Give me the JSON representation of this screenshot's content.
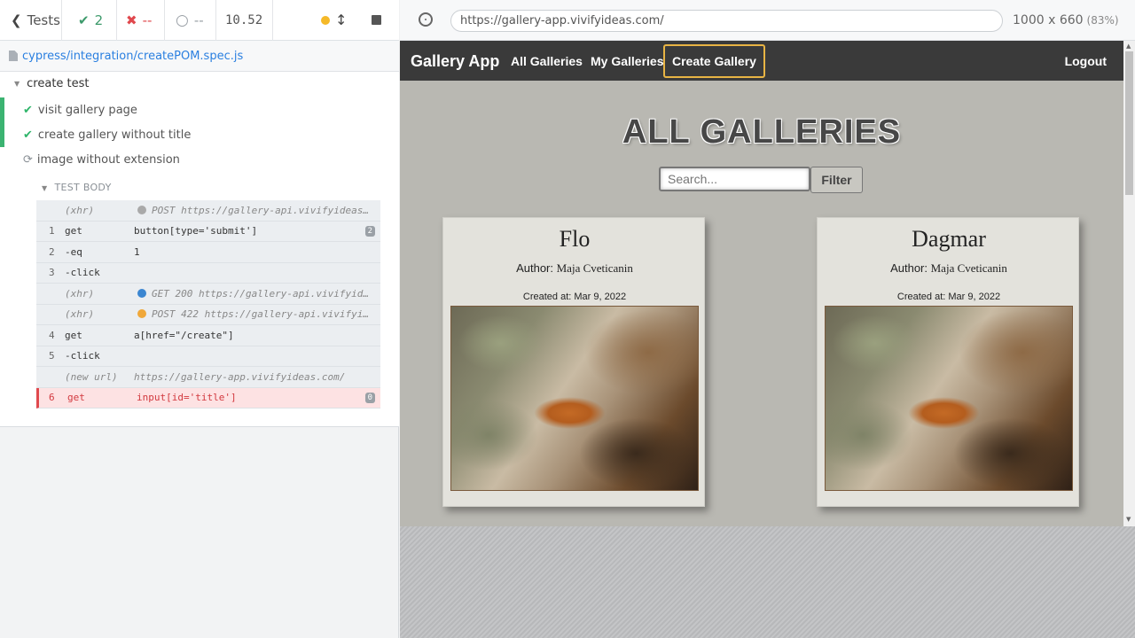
{
  "runner": {
    "tests_button": "Tests",
    "passed_count": "2",
    "failed_count": "--",
    "pending_count": "--",
    "duration": "10.52",
    "spec_file": "cypress/integration/createPOM.spec.js",
    "suite_title": "create test",
    "tests": [
      {
        "label": "visit gallery page",
        "state": "passed"
      },
      {
        "label": "create gallery without title",
        "state": "passed"
      },
      {
        "label": "image without extension",
        "state": "running"
      }
    ],
    "test_body_label": "TEST BODY",
    "commands": [
      {
        "num": "",
        "name": "(xhr)",
        "dot": "#a9a9a9",
        "msg": "POST https://gallery-api.vivifyideas...",
        "type": "xhr",
        "badge": ""
      },
      {
        "num": "1",
        "name": "get",
        "dot": "",
        "msg": "button[type='submit']",
        "type": "cmd",
        "badge": "2"
      },
      {
        "num": "2",
        "name": "-eq",
        "dot": "",
        "msg": "1",
        "type": "cmd",
        "badge": ""
      },
      {
        "num": "3",
        "name": "-click",
        "dot": "",
        "msg": "",
        "type": "cmd",
        "badge": ""
      },
      {
        "num": "",
        "name": "(xhr)",
        "dot": "#3b86d1",
        "msg": "GET 200 https://gallery-api.vivifyide...",
        "type": "xhr",
        "badge": ""
      },
      {
        "num": "",
        "name": "(xhr)",
        "dot": "#f0a83a",
        "msg": "POST 422 https://gallery-api.vivifyid...",
        "type": "xhr",
        "badge": ""
      },
      {
        "num": "4",
        "name": "get",
        "dot": "",
        "msg": "a[href=\"/create\"]",
        "type": "cmd",
        "badge": ""
      },
      {
        "num": "5",
        "name": "-click",
        "dot": "",
        "msg": "",
        "type": "cmd",
        "badge": ""
      },
      {
        "num": "",
        "name": "(new url)",
        "dot": "",
        "msg": "https://gallery-app.vivifyideas.com/",
        "type": "newurl",
        "badge": ""
      },
      {
        "num": "6",
        "name": "get",
        "dot": "",
        "msg": "input[id='title']",
        "type": "failed",
        "badge": "0"
      }
    ]
  },
  "aut": {
    "url": "https://gallery-app.vivifyideas.com/",
    "viewport": "1000 x 660",
    "scale": "(83%)"
  },
  "app": {
    "brand": "Gallery App",
    "nav": {
      "all_galleries": "All Galleries",
      "my_galleries": "My Galleries",
      "create_gallery": "Create Gallery",
      "logout": "Logout"
    },
    "page_title": "ALL GALLERIES",
    "search_placeholder": "Search...",
    "filter_button": "Filter",
    "galleries": [
      {
        "title": "Flo",
        "author_label": "Author:",
        "author": "Maja Cveticanin",
        "created": "Created at: Mar 9, 2022"
      },
      {
        "title": "Dagmar",
        "author_label": "Author:",
        "author": "Maja Cveticanin",
        "created": "Created at: Mar 9, 2022"
      }
    ]
  },
  "colors": {
    "passed": "#3bb371",
    "failed": "#e0484d",
    "accent_link": "#2a7fe0",
    "nav_bg": "#3a3a3a",
    "create_border": "#e8b444",
    "page_bg": "#b9b8b2"
  }
}
